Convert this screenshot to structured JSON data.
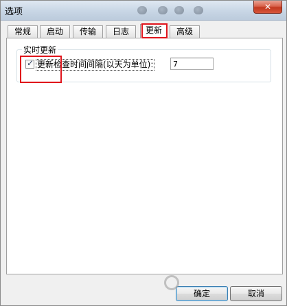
{
  "window": {
    "title": "选项",
    "close_glyph": "✕"
  },
  "tabs": [
    {
      "label": "常规"
    },
    {
      "label": "启动"
    },
    {
      "label": "传输"
    },
    {
      "label": "日志"
    },
    {
      "label": "更新"
    },
    {
      "label": "高级"
    }
  ],
  "active_tab_index": 4,
  "update_group": {
    "title": "实时更新",
    "check_interval": {
      "checked": true,
      "label": "更新检查时间间隔(以天为单位):",
      "value": "7"
    }
  },
  "buttons": {
    "ok_label": "确定",
    "cancel_label": "取消"
  },
  "colors": {
    "highlight": "#e0141b"
  }
}
